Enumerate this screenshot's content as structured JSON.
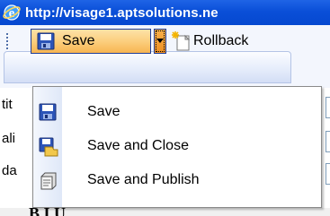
{
  "window": {
    "url_title": "http://visage1.aptsolutions.ne"
  },
  "toolbar": {
    "save_label": "Save",
    "rollback_label": "Rollback"
  },
  "background_labels": [
    "tit",
    "ali",
    "da"
  ],
  "menu": {
    "items": [
      {
        "label": "Save",
        "icon": "floppy-disk-icon"
      },
      {
        "label": "Save and Close",
        "icon": "save-and-close-icon"
      },
      {
        "label": "Save and Publish",
        "icon": "publish-icon"
      }
    ]
  },
  "colors": {
    "titlebar": "#0a4fd8",
    "save_button_highlight": "#fbcd7a",
    "split_arrow_pressed": "#ee8f22",
    "menu_border": "#8a8a8a"
  }
}
